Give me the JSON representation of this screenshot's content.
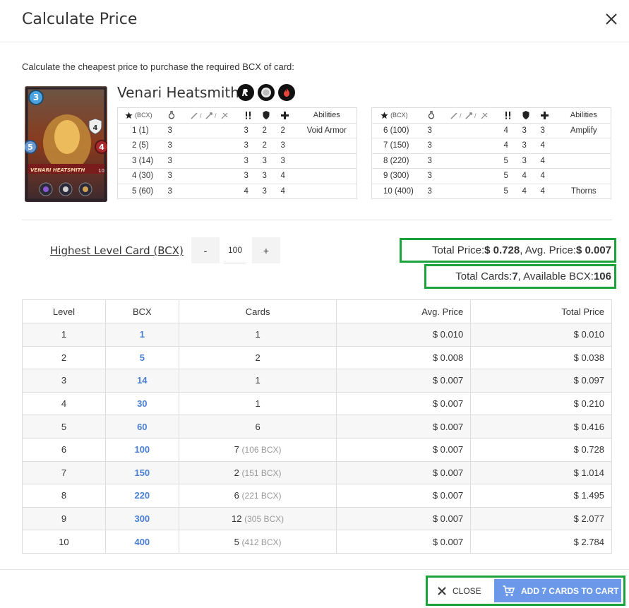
{
  "dialog": {
    "title": "Calculate Price",
    "close_icon": "close-icon",
    "instruction": "Calculate the cheapest price to purchase the required BCX of card:"
  },
  "card": {
    "name": "Venari Heatsmith",
    "art_label": "VENARI HEATSMITH",
    "art_level": "10",
    "art_stats": {
      "mana": "3",
      "attack": "4",
      "speed": "5",
      "health": "4"
    },
    "badges": [
      "rarity-icon",
      "edition-icon",
      "fire-element-icon"
    ]
  },
  "stats_table": {
    "headers": {
      "bcx": "(BCX)",
      "abilities": "Abilities"
    },
    "header_icons": [
      "star-icon",
      "mana-icon",
      "attack-icons",
      "speed-icon",
      "armor-icon",
      "health-icon"
    ],
    "left_rows": [
      {
        "level": "1 (1)",
        "mana": "3",
        "speed": "3",
        "armor": "2",
        "health": "2",
        "ability": "Void Armor"
      },
      {
        "level": "2 (5)",
        "mana": "3",
        "speed": "3",
        "armor": "2",
        "health": "3",
        "ability": ""
      },
      {
        "level": "3 (14)",
        "mana": "3",
        "speed": "3",
        "armor": "3",
        "health": "3",
        "ability": ""
      },
      {
        "level": "4 (30)",
        "mana": "3",
        "speed": "3",
        "armor": "3",
        "health": "4",
        "ability": ""
      },
      {
        "level": "5 (60)",
        "mana": "3",
        "speed": "4",
        "armor": "3",
        "health": "4",
        "ability": ""
      }
    ],
    "right_rows": [
      {
        "level": "6 (100)",
        "mana": "3",
        "speed": "4",
        "armor": "3",
        "health": "3",
        "ability": "Amplify"
      },
      {
        "level": "7 (150)",
        "mana": "3",
        "speed": "4",
        "armor": "3",
        "health": "4",
        "ability": ""
      },
      {
        "level": "8 (220)",
        "mana": "3",
        "speed": "5",
        "armor": "3",
        "health": "4",
        "ability": ""
      },
      {
        "level": "9 (300)",
        "mana": "3",
        "speed": "5",
        "armor": "4",
        "health": "4",
        "ability": ""
      },
      {
        "level": "10 (400)",
        "mana": "3",
        "speed": "5",
        "armor": "4",
        "health": "4",
        "ability": "Thorns"
      }
    ]
  },
  "controls": {
    "highest_level_label": "Highest Level Card (BCX)",
    "minus_label": "-",
    "plus_label": "+",
    "bcx_value": "100"
  },
  "summary": {
    "total_price_label": "Total Price: ",
    "total_price_value": "$ 0.728",
    "avg_price_label": ", Avg. Price: ",
    "avg_price_value": "$ 0.007",
    "total_cards_label": "Total Cards: ",
    "total_cards_value": "7",
    "available_bcx_label": ", Available BCX: ",
    "available_bcx_value": "106"
  },
  "price_table": {
    "headers": [
      "Level",
      "BCX",
      "Cards",
      "Avg. Price",
      "Total Price"
    ],
    "rows": [
      {
        "level": "1",
        "bcx": "1",
        "cards": "1",
        "cards_note": "",
        "avg": "$ 0.010",
        "total": "$ 0.010"
      },
      {
        "level": "2",
        "bcx": "5",
        "cards": "2",
        "cards_note": "",
        "avg": "$ 0.008",
        "total": "$ 0.038"
      },
      {
        "level": "3",
        "bcx": "14",
        "cards": "1",
        "cards_note": "",
        "avg": "$ 0.007",
        "total": "$ 0.097"
      },
      {
        "level": "4",
        "bcx": "30",
        "cards": "1",
        "cards_note": "",
        "avg": "$ 0.007",
        "total": "$ 0.210"
      },
      {
        "level": "5",
        "bcx": "60",
        "cards": "6",
        "cards_note": "",
        "avg": "$ 0.007",
        "total": "$ 0.416"
      },
      {
        "level": "6",
        "bcx": "100",
        "cards": "7",
        "cards_note": "(106 BCX)",
        "avg": "$ 0.007",
        "total": "$ 0.728"
      },
      {
        "level": "7",
        "bcx": "150",
        "cards": "2",
        "cards_note": "(151 BCX)",
        "avg": "$ 0.007",
        "total": "$ 1.014"
      },
      {
        "level": "8",
        "bcx": "220",
        "cards": "6",
        "cards_note": "(221 BCX)",
        "avg": "$ 0.007",
        "total": "$ 1.495"
      },
      {
        "level": "9",
        "bcx": "300",
        "cards": "12",
        "cards_note": "(305 BCX)",
        "avg": "$ 0.007",
        "total": "$ 2.077"
      },
      {
        "level": "10",
        "bcx": "400",
        "cards": "5",
        "cards_note": "(412 BCX)",
        "avg": "$ 0.007",
        "total": "$ 2.784"
      }
    ]
  },
  "footer": {
    "close_label": "CLOSE",
    "add_to_cart_label": "ADD 7 CARDS TO CART",
    "cart_icon": "cart-icon"
  },
  "colors": {
    "accent_blue": "#6b98e8",
    "link_blue": "#4a7fd4",
    "highlight_green": "#1aa33a"
  }
}
